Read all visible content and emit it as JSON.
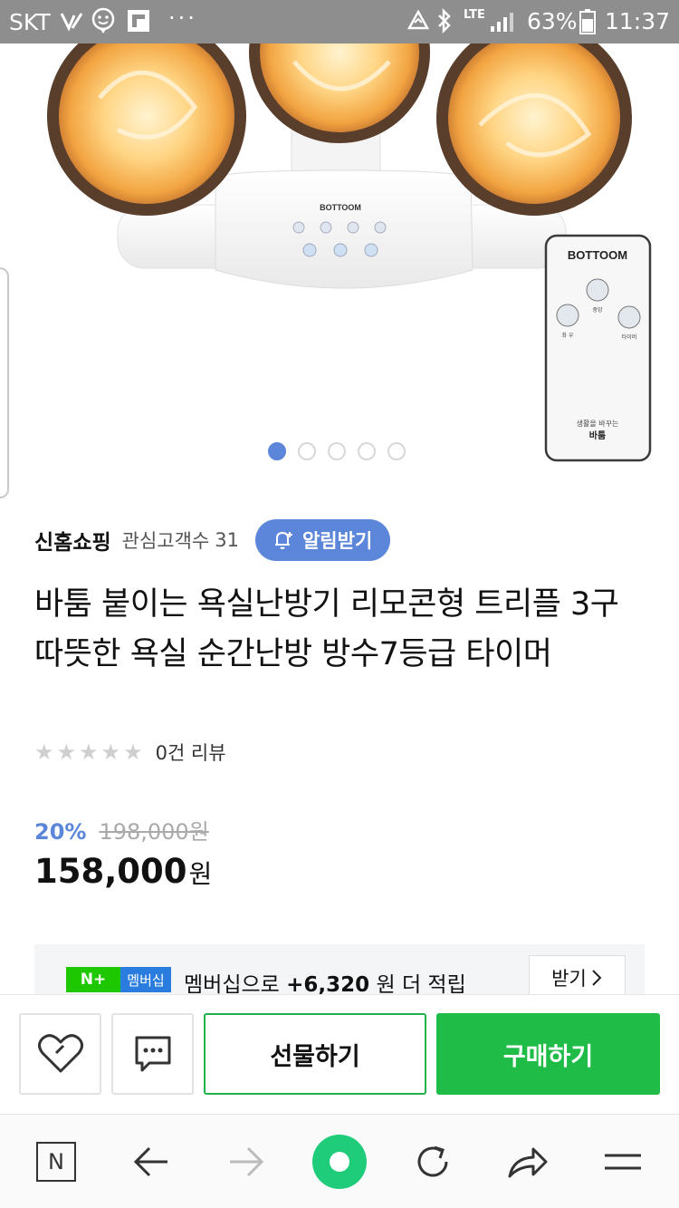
{
  "status_bar": {
    "carrier": "SKT",
    "battery": "63%",
    "time": "11:37",
    "network": "LTE"
  },
  "product_image": {
    "brand_on_device": "BOTTOOM",
    "remote_brand": "BOTTOOM",
    "remote_caption_1": "생활을 바꾸는",
    "remote_caption_2": "바툼",
    "remote_btn_center": "중앙",
    "remote_btn_left": "좌 우",
    "remote_btn_right": "타이머"
  },
  "carousel": {
    "total": 5,
    "active_index": 0
  },
  "seller": {
    "name": "신홈쇼핑",
    "follower_label": "관심고객수",
    "follower_count": "31",
    "alarm_label": "알림받기"
  },
  "product": {
    "title": "바툼 붙이는 욕실난방기 리모콘형 트리플 3구 따뜻한 욕실 순간난방 방수7등급 타이머",
    "review_text": "0건 리뷰",
    "rating": 0,
    "rating_max": 5,
    "discount_rate": "20%",
    "original_price": "198,000원",
    "sale_price": "158,000",
    "sale_unit": "원"
  },
  "membership": {
    "badge_np": "N+",
    "badge_label": "멤버십",
    "text_prefix": "멤버십으로",
    "points": "+6,320",
    "text_suffix": "원 더 적립",
    "receive_label": "받기"
  },
  "actions": {
    "gift_label": "선물하기",
    "buy_label": "구매하기"
  },
  "browser_nav": {
    "home_letter": "N"
  },
  "colors": {
    "accent_blue": "#5b86d9",
    "buy_green": "#1fbc47",
    "membership_green": "#1ec800",
    "membership_blue": "#2a7dde",
    "nav_green": "#1fcc7a"
  }
}
